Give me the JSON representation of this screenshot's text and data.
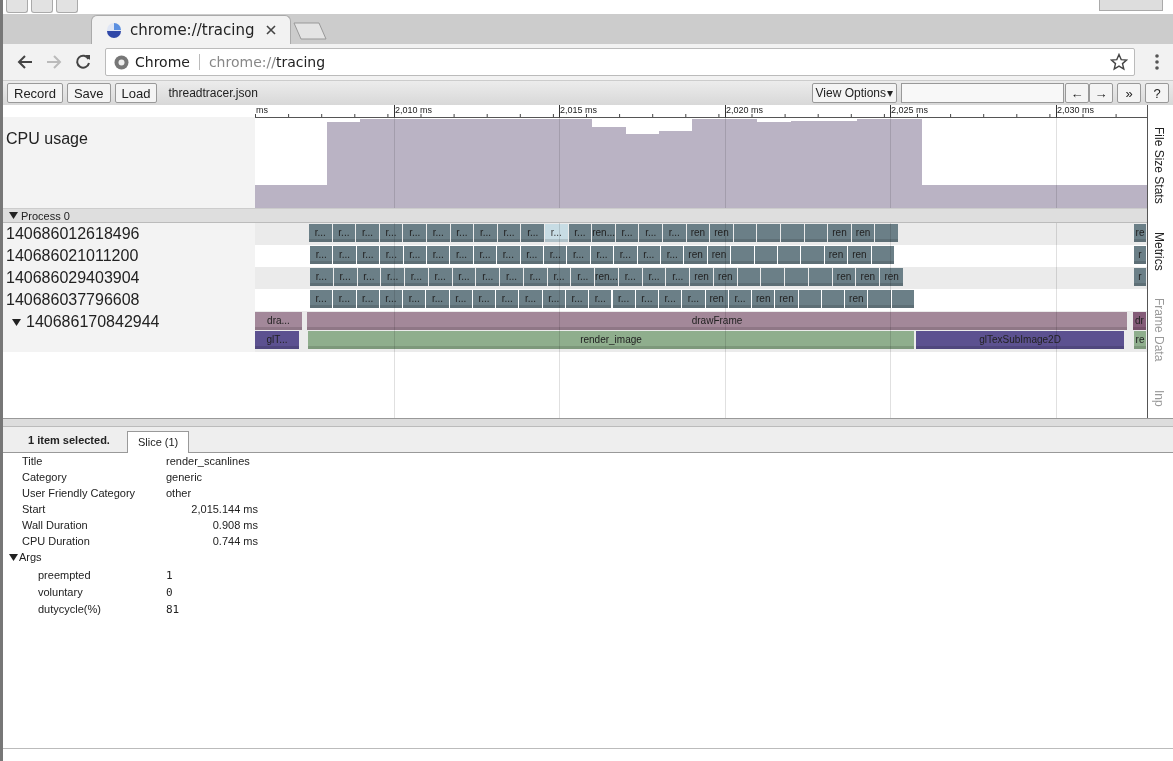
{
  "tabs": [
    {
      "title": "chrome://tracing",
      "selected": true
    }
  ],
  "address_bar": {
    "site_label": "Chrome",
    "url_scheme": "chrome://",
    "url_path": "tracing"
  },
  "toolbar": {
    "buttons": [
      "Record",
      "Save",
      "Load"
    ],
    "file_name": "threadtracer.json",
    "view_options": "View Options",
    "view_options_caret": "▾",
    "nav_buttons": [
      "←",
      "→"
    ],
    "extra_buttons": [
      "»",
      "?"
    ]
  },
  "timeline": {
    "ruler_labels": [
      "ms",
      "2,010 ms",
      "2,015 ms",
      "2,020 ms",
      "2,025 ms",
      "2,030 ms"
    ],
    "cpu_track": {
      "label": "CPU usage"
    },
    "process": {
      "label": "Process 0",
      "expanded": true
    },
    "threads": [
      {
        "name": "140686012618496",
        "kind": "single",
        "rows": [
          {
            "slices": [
              {
                "label": "r...",
                "selected": false
              },
              {
                "label": "r...",
                "selected": false
              },
              {
                "label": "r...",
                "selected": false
              },
              {
                "label": "r...",
                "selected": false
              },
              {
                "label": "r...",
                "selected": false
              },
              {
                "label": "r...",
                "selected": false
              },
              {
                "label": "r...",
                "selected": false
              },
              {
                "label": "r...",
                "selected": false
              },
              {
                "label": "r...",
                "selected": false
              },
              {
                "label": "r...",
                "selected": false
              },
              {
                "label": "r...",
                "selected": true
              },
              {
                "label": "r...",
                "selected": false
              },
              {
                "label": "ren...",
                "selected": false
              },
              {
                "label": "r...",
                "selected": false
              },
              {
                "label": "r...",
                "selected": false
              },
              {
                "label": "r...",
                "selected": false
              },
              {
                "label": "ren",
                "selected": false
              },
              {
                "label": "ren",
                "selected": false
              },
              {
                "selected": false
              },
              {
                "selected": false
              },
              {
                "selected": false
              },
              {
                "selected": false
              },
              {
                "label": "ren",
                "selected": false
              },
              {
                "label": "ren",
                "selected": false
              },
              {
                "selected": false
              },
              {
                "label": "re",
                "selected": false
              }
            ]
          }
        ]
      },
      {
        "name": "140686021011200",
        "kind": "single",
        "rows": [
          {
            "slices": [
              {
                "label": "r...",
                "selected": false
              },
              {
                "label": "r...",
                "selected": false
              },
              {
                "label": "r...",
                "selected": false
              },
              {
                "label": "r...",
                "selected": false
              },
              {
                "label": "r...",
                "selected": false
              },
              {
                "label": "r...",
                "selected": false
              },
              {
                "label": "r...",
                "selected": false
              },
              {
                "label": "r...",
                "selected": false
              },
              {
                "label": "r...",
                "selected": false
              },
              {
                "label": "r...",
                "selected": false
              },
              {
                "label": "r...",
                "selected": false
              },
              {
                "label": "r...",
                "selected": false
              },
              {
                "label": "r...",
                "selected": false
              },
              {
                "label": "r...",
                "selected": false
              },
              {
                "label": "r...",
                "selected": false
              },
              {
                "label": "r...",
                "selected": false
              },
              {
                "label": "ren",
                "selected": false
              },
              {
                "label": "ren",
                "selected": false
              },
              {
                "selected": false
              },
              {
                "selected": false
              },
              {
                "selected": false
              },
              {
                "selected": false
              },
              {
                "label": "ren",
                "selected": false
              },
              {
                "label": "ren",
                "selected": false
              },
              {
                "selected": false
              },
              {
                "label": "r",
                "selected": false
              }
            ]
          }
        ]
      },
      {
        "name": "140686029403904",
        "kind": "single",
        "rows": [
          {
            "slices": [
              {
                "label": "r...",
                "selected": false
              },
              {
                "label": "r...",
                "selected": false
              },
              {
                "label": "r...",
                "selected": false
              },
              {
                "label": "r...",
                "selected": false
              },
              {
                "label": "r...",
                "selected": false
              },
              {
                "label": "r...",
                "selected": false
              },
              {
                "label": "r...",
                "selected": false
              },
              {
                "label": "r...",
                "selected": false
              },
              {
                "label": "r...",
                "selected": false
              },
              {
                "label": "r...",
                "selected": false
              },
              {
                "label": "r...",
                "selected": false
              },
              {
                "label": "r...",
                "selected": false
              },
              {
                "label": "ren...",
                "selected": false
              },
              {
                "label": "r...",
                "selected": false
              },
              {
                "label": "r...",
                "selected": false
              },
              {
                "label": "r...",
                "selected": false
              },
              {
                "label": "ren",
                "selected": false
              },
              {
                "label": "ren",
                "selected": false
              },
              {
                "selected": false
              },
              {
                "selected": false
              },
              {
                "selected": false
              },
              {
                "selected": false
              },
              {
                "label": "ren",
                "selected": false
              },
              {
                "label": "ren",
                "selected": false
              },
              {
                "label": "ren",
                "selected": false
              },
              {
                "label": "r",
                "selected": false
              }
            ]
          }
        ]
      },
      {
        "name": "140686037796608",
        "kind": "single",
        "rows": [
          {
            "slices": [
              {
                "label": "r...",
                "selected": false
              },
              {
                "label": "r...",
                "selected": false
              },
              {
                "label": "r...",
                "selected": false
              },
              {
                "label": "r...",
                "selected": false
              },
              {
                "label": "r...",
                "selected": false
              },
              {
                "label": "r...",
                "selected": false
              },
              {
                "label": "r...",
                "selected": false
              },
              {
                "label": "r...",
                "selected": false
              },
              {
                "label": "r...",
                "selected": false
              },
              {
                "label": "r...",
                "selected": false
              },
              {
                "label": "r...",
                "selected": false
              },
              {
                "label": "r...",
                "selected": false
              },
              {
                "label": "r...",
                "selected": false
              },
              {
                "label": "r...",
                "selected": false
              },
              {
                "label": "r...",
                "selected": false
              },
              {
                "label": "r...",
                "selected": false
              },
              {
                "label": "r...",
                "selected": false
              },
              {
                "label": "ren",
                "selected": false
              },
              {
                "label": "r...",
                "selected": false
              },
              {
                "label": "ren",
                "selected": false
              },
              {
                "label": "ren",
                "selected": false
              },
              {
                "selected": false
              },
              {
                "selected": false
              },
              {
                "label": "ren",
                "selected": false
              },
              {
                "selected": false
              },
              {
                "selected": false
              }
            ]
          }
        ]
      },
      {
        "name": "140686170842944",
        "kind": "nested",
        "expanded": true,
        "rows": [
          {
            "slices": [
              {
                "label": "dra...",
                "color": "#a3889a",
                "selected": false
              },
              {
                "label": "drawFrame",
                "color": "#a38899",
                "selected": false
              },
              {
                "label": "dr",
                "color": "#845c78",
                "selected": false
              }
            ]
          },
          {
            "slices": [
              {
                "label": "glT...",
                "color": "#5c5190",
                "selected": false
              },
              {
                "label": "render_image",
                "color": "#8fae8d",
                "selected": false
              },
              {
                "label": "glTexSubImage2D",
                "color": "#5c5190",
                "selected": false
              },
              {
                "label": "re",
                "color": "#8fae8d",
                "selected": false
              }
            ]
          }
        ]
      }
    ],
    "side_tabs": [
      {
        "label": "File Size Stats",
        "disabled": false
      },
      {
        "label": "Metrics",
        "disabled": false
      },
      {
        "label": "Frame Data",
        "disabled": true
      },
      {
        "label": "Inp",
        "disabled": true
      }
    ]
  },
  "details": {
    "summary": "1 item selected.",
    "tabs": [
      {
        "label": "Slice (1)",
        "selected": true
      }
    ],
    "fields": [
      {
        "key": "Title",
        "value": "render_scanlines",
        "kind": "text"
      },
      {
        "key": "Category",
        "value": "generic",
        "kind": "text"
      },
      {
        "key": "User Friendly Category",
        "value": "other",
        "kind": "text"
      },
      {
        "key": "Start",
        "value": "2,015.144 ms",
        "kind": "number"
      },
      {
        "key": "Wall Duration",
        "value": "0.908 ms",
        "kind": "number"
      },
      {
        "key": "CPU Duration",
        "value": "0.744 ms",
        "kind": "number"
      }
    ],
    "args": {
      "label": "Args",
      "expanded": true,
      "items": [
        {
          "key": "preempted",
          "value": "1"
        },
        {
          "key": "voluntary",
          "value": "0"
        },
        {
          "key": "dutycycle(%)",
          "value": "81"
        }
      ]
    }
  }
}
